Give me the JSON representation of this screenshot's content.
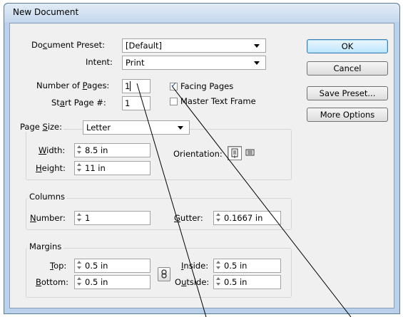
{
  "window": {
    "title": "New Document"
  },
  "form": {
    "preset": {
      "label": "Document Preset:",
      "label_u_pre": "Do",
      "label_u": "c",
      "label_post": "ument Preset:",
      "value": "[Default]"
    },
    "intent": {
      "label": "Intent:",
      "value": "Print"
    },
    "pages": {
      "label_pre": "Number of ",
      "label_u": "P",
      "label_post": "ages:",
      "value": "1"
    },
    "start_page": {
      "label_pre": "St",
      "label_u": "a",
      "label_post": "rt Page #:",
      "value": "1"
    },
    "facing_pages": {
      "label": "Facing Pages",
      "checked": true
    },
    "master_text_frame": {
      "label": "Master Text Frame",
      "checked": false
    },
    "page_size": {
      "label_pre": "Page ",
      "label_u": "S",
      "label_post": "ize:",
      "value": "Letter"
    },
    "width": {
      "label_u": "W",
      "label_post": "idth:",
      "value": "8.5 in"
    },
    "height": {
      "label_u": "H",
      "label_post": "eight:",
      "value": "11 in"
    },
    "orientation": {
      "label": "Orientation:",
      "selected": "portrait"
    }
  },
  "columns": {
    "title": "Columns",
    "number": {
      "label_u": "N",
      "label_post": "umber:",
      "value": "1"
    },
    "gutter": {
      "label_u": "G",
      "label_post": "utter:",
      "value": "0.1667 in"
    }
  },
  "margins": {
    "title": "Margins",
    "top": {
      "label_u": "T",
      "label_post": "op:",
      "value": "0.5 in"
    },
    "bottom": {
      "label_u": "B",
      "label_post": "ottom:",
      "value": "0.5 in"
    },
    "inside": {
      "label_u": "I",
      "label_post": "nside:",
      "value": "0.5 in"
    },
    "outside": {
      "label_pre": "O",
      "label_u": "u",
      "label_post": "tside:",
      "value": "0.5 in"
    },
    "link_icon": "chain-link-icon"
  },
  "buttons": {
    "ok": "OK",
    "cancel": "Cancel",
    "save_preset": "Save Preset...",
    "more_options": "More Options"
  },
  "icons": {
    "portrait": "portrait-orientation-icon",
    "landscape": "landscape-orientation-icon",
    "spinner": "spinner-arrows-icon"
  }
}
